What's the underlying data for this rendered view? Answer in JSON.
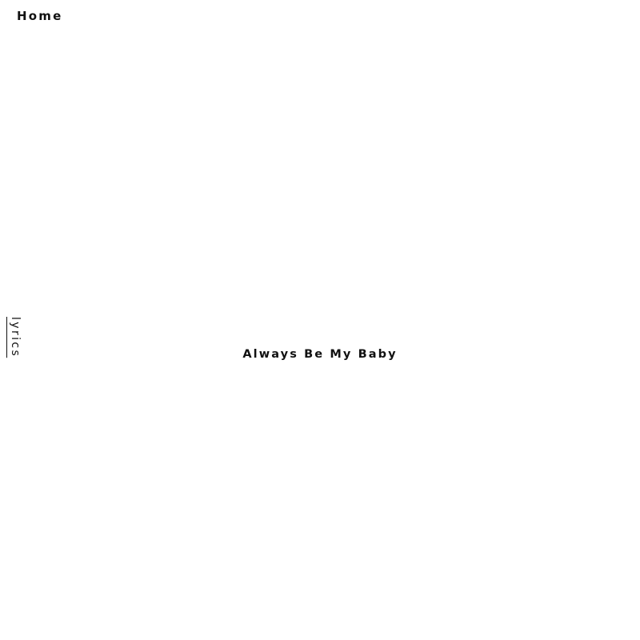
{
  "nav": {
    "home_label": "Home",
    "side_link_label": "lyrics"
  },
  "main": {
    "title": "Always Be My Baby"
  },
  "colors": {
    "background": "#ffffff",
    "text": "#111111"
  }
}
